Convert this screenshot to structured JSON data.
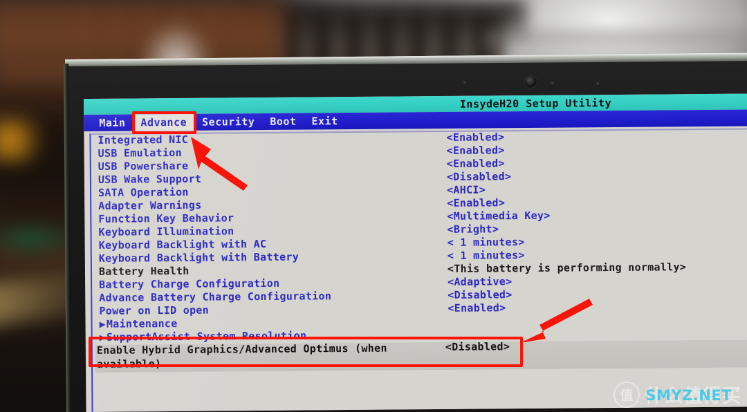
{
  "bios": {
    "title": "InsydeH20 Setup Utility",
    "menu": [
      {
        "label": "Main",
        "active": false
      },
      {
        "label": "Advance",
        "active": true
      },
      {
        "label": "Security",
        "active": false
      },
      {
        "label": "Boot",
        "active": false
      },
      {
        "label": "Exit",
        "active": false
      }
    ],
    "rows": [
      {
        "label": "Integrated NIC",
        "value": "<Enabled>",
        "dim": false,
        "submenu": false
      },
      {
        "label": "USB Emulation",
        "value": "<Enabled>",
        "dim": false,
        "submenu": false
      },
      {
        "label": "USB Powershare",
        "value": "<Enabled>",
        "dim": false,
        "submenu": false
      },
      {
        "label": "USB Wake Support",
        "value": "<Disabled>",
        "dim": false,
        "submenu": false
      },
      {
        "label": "SATA Operation",
        "value": "<AHCI>",
        "dim": false,
        "submenu": false
      },
      {
        "label": "Adapter Warnings",
        "value": "<Enabled>",
        "dim": false,
        "submenu": false
      },
      {
        "label": "Function Key Behavior",
        "value": "<Multimedia Key>",
        "dim": false,
        "submenu": false
      },
      {
        "label": "Keyboard Illumination",
        "value": "<Bright>",
        "dim": false,
        "submenu": false
      },
      {
        "label": "Keyboard Backlight with AC",
        "value": "< 1 minutes>",
        "dim": false,
        "submenu": false
      },
      {
        "label": "Keyboard Backlight with Battery",
        "value": "< 1 minutes>",
        "dim": false,
        "submenu": false
      },
      {
        "label": "Battery Health",
        "value": "<This battery is performing normally>",
        "dim": true,
        "submenu": false
      },
      {
        "label": "Battery Charge Configuration",
        "value": "<Adaptive>",
        "dim": false,
        "submenu": false
      },
      {
        "label": "Advance Battery Charge Configuration",
        "value": "<Disabled>",
        "dim": false,
        "submenu": false
      },
      {
        "label": "Power on LID open",
        "value": "<Enabled>",
        "dim": false,
        "submenu": false
      },
      {
        "label": "Maintenance",
        "value": "",
        "dim": false,
        "submenu": true
      },
      {
        "label": "SupportAssist System Resolution",
        "value": "",
        "dim": false,
        "submenu": true
      }
    ],
    "selected_row": {
      "label": "Enable Hybrid Graphics/Advanced Optimus (when available)",
      "value": "<Disabled>"
    }
  },
  "annotations": {
    "tab_highlight_target": "Advance",
    "row_highlight_target": "Enable Hybrid Graphics/Advanced Optimus (when available)",
    "arrow_color": "#fb1408",
    "box_color": "#fb1408"
  },
  "theme": {
    "title_bar": "#35cec3",
    "menu_bar": "#1f1ccb",
    "panel_bg": "#d6d4cf",
    "text_blue": "#2b28c4",
    "text_dim": "#1b1b1b",
    "selected_row_bg": "#c6c4bf"
  },
  "watermark": {
    "logo_char": "值",
    "text": "什么值得买",
    "domain": "SMYZ.NET"
  }
}
